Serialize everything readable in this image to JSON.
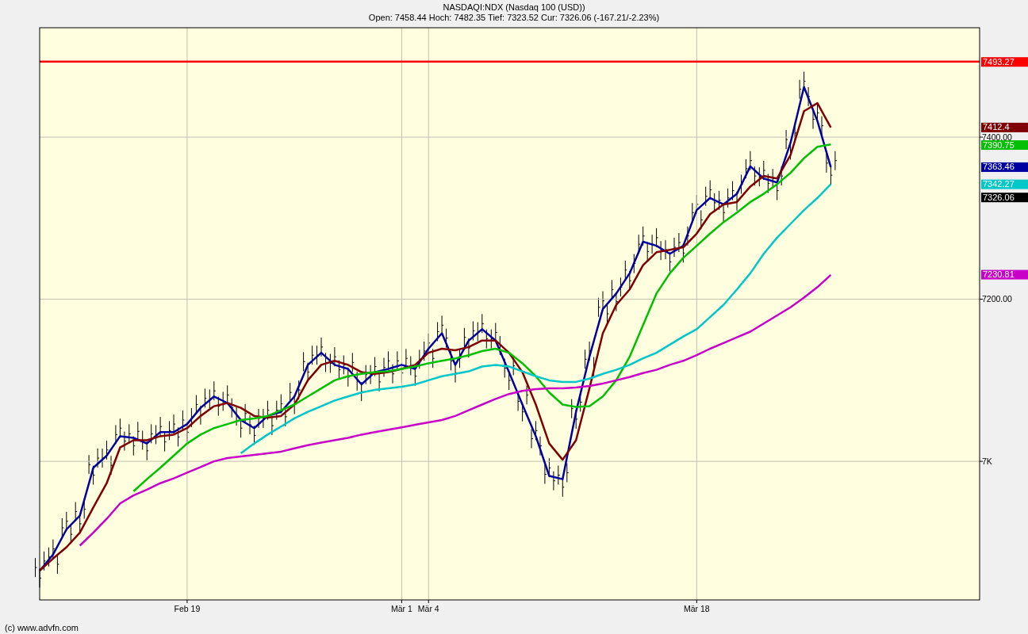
{
  "header": {
    "title": "NASDAQI:NDX (Nasdaq 100 (USD))",
    "stats": "Open: 7458.44 Hoch: 7482.35 Tief: 7323.52 Cur: 7326.06 (-167.21/-2.23%)"
  },
  "chart_data": {
    "type": "line",
    "grid": true,
    "categories": [
      null,
      null,
      null,
      null,
      null,
      null,
      null,
      null,
      null,
      null,
      null,
      "Feb 19",
      null,
      null,
      null,
      null,
      null,
      null,
      null,
      null,
      null,
      null,
      null,
      null,
      null,
      null,
      null,
      "Mär 1",
      null,
      "Mär 4",
      null,
      null,
      null,
      null,
      null,
      null,
      null,
      null,
      null,
      null,
      null,
      null,
      null,
      null,
      null,
      null,
      null,
      null,
      null,
      "Mär 18",
      null,
      null,
      null,
      null,
      null,
      null,
      null,
      null,
      null,
      null,
      null,
      null,
      null,
      null,
      null,
      null,
      null,
      null,
      null,
      null,
      null
    ],
    "ylim": [
      6829,
      7535
    ],
    "yticks": [
      {
        "value": 7000,
        "label": "7K"
      },
      {
        "value": 7200,
        "label": "7200.00"
      },
      {
        "value": 7400,
        "label": "7400.00"
      }
    ],
    "ref_lines": [
      {
        "axis": "y",
        "value": 7493.27,
        "label": "7493.27",
        "color": "#ff0000"
      }
    ],
    "series": [
      {
        "color": "#0000a0",
        "values": [
          6865,
          6885,
          6916,
          6933,
          6992,
          7007,
          7031,
          7029,
          7022,
          7036,
          7036,
          7046,
          7066,
          7080,
          7072,
          7051,
          7041,
          7056,
          7061,
          7080,
          7119,
          7134,
          7119,
          7114,
          7095,
          7110,
          7114,
          7119,
          7114,
          7139,
          7158,
          7119,
          7149,
          7163,
          7149,
          7110,
          7070,
          7031,
          6982,
          6978,
          7061,
          7129,
          7188,
          7207,
          7232,
          7271,
          7266,
          7256,
          7266,
          7310,
          7325,
          7317,
          7330,
          7364,
          7349,
          7344,
          7393,
          7462,
          7420,
          7363,
          null,
          null,
          null,
          null,
          null,
          null,
          null,
          null,
          null,
          null,
          null
        ]
      },
      {
        "color": "#800000",
        "values": [
          6865,
          6880,
          6894,
          6912,
          6943,
          6973,
          7017,
          7026,
          7026,
          7031,
          7033,
          7041,
          7056,
          7068,
          7072,
          7066,
          7056,
          7054,
          7056,
          7070,
          7100,
          7119,
          7124,
          7119,
          7110,
          7108,
          7110,
          7114,
          7119,
          7134,
          7139,
          7137,
          7141,
          7149,
          7149,
          7134,
          7110,
          7070,
          7022,
          7002,
          7026,
          7090,
          7158,
          7193,
          7212,
          7242,
          7258,
          7261,
          7264,
          7281,
          7305,
          7317,
          7320,
          7339,
          7352,
          7349,
          7378,
          7432,
          7442,
          7412,
          null,
          null,
          null,
          null,
          null,
          null,
          null,
          null,
          null,
          null,
          null
        ]
      },
      {
        "color": "#00c000",
        "values": [
          null,
          null,
          null,
          null,
          null,
          null,
          null,
          6963,
          6978,
          6992,
          7007,
          7022,
          7033,
          7041,
          7046,
          7051,
          7053,
          7056,
          7063,
          7070,
          7080,
          7090,
          7100,
          7105,
          7108,
          7110,
          7111,
          7114,
          7117,
          7121,
          7124,
          7127,
          7131,
          7136,
          7139,
          7134,
          7121,
          7105,
          7085,
          7070,
          7067,
          7068,
          7080,
          7100,
          7129,
          7168,
          7207,
          7232,
          7251,
          7266,
          7281,
          7295,
          7307,
          7320,
          7330,
          7342,
          7356,
          7374,
          7388,
          7391,
          null,
          null,
          null,
          null,
          null,
          null,
          null,
          null,
          null,
          null,
          null
        ]
      },
      {
        "color": "#00c8c8",
        "values": [
          null,
          null,
          null,
          null,
          null,
          null,
          null,
          null,
          null,
          null,
          null,
          null,
          null,
          null,
          null,
          7010,
          7022,
          7033,
          7043,
          7053,
          7061,
          7068,
          7075,
          7080,
          7085,
          7088,
          7090,
          7092,
          7095,
          7100,
          7105,
          7108,
          7111,
          7117,
          7119,
          7117,
          7111,
          7105,
          7100,
          7098,
          7098,
          7102,
          7108,
          7113,
          7119,
          7127,
          7134,
          7144,
          7154,
          7163,
          7178,
          7193,
          7212,
          7232,
          7256,
          7276,
          7293,
          7310,
          7325,
          7342,
          null,
          null,
          null,
          null,
          null,
          null,
          null,
          null,
          null,
          null,
          null
        ]
      },
      {
        "color": "#c800c8",
        "values": [
          null,
          null,
          null,
          6896,
          6912,
          6929,
          6948,
          6958,
          6965,
          6973,
          6979,
          6986,
          6993,
          7000,
          7004,
          7006,
          7008,
          7010,
          7012,
          7016,
          7020,
          7023,
          7026,
          7029,
          7033,
          7036,
          7039,
          7042,
          7045,
          7048,
          7051,
          7056,
          7063,
          7070,
          7077,
          7083,
          7087,
          7089,
          7090,
          7090,
          7091,
          7093,
          7096,
          7100,
          7104,
          7109,
          7113,
          7119,
          7124,
          7131,
          7139,
          7146,
          7153,
          7160,
          7170,
          7180,
          7190,
          7202,
          7215,
          7230,
          null,
          null,
          null,
          null,
          null,
          null,
          null,
          null,
          null,
          null,
          null
        ]
      }
    ]
  },
  "value_tags": [
    {
      "text": "7412.4",
      "color": "#800000"
    },
    {
      "text": "7390.75",
      "color": "#00c000"
    },
    {
      "text": "7363.46",
      "color": "#0000a0"
    },
    {
      "text": "7342.27",
      "color": "#00c8c8"
    },
    {
      "text": "7326.06",
      "color": "#000000"
    },
    {
      "text": "7230.81",
      "color": "#c800c8"
    }
  ],
  "footer": "(c) www.advfn.com"
}
